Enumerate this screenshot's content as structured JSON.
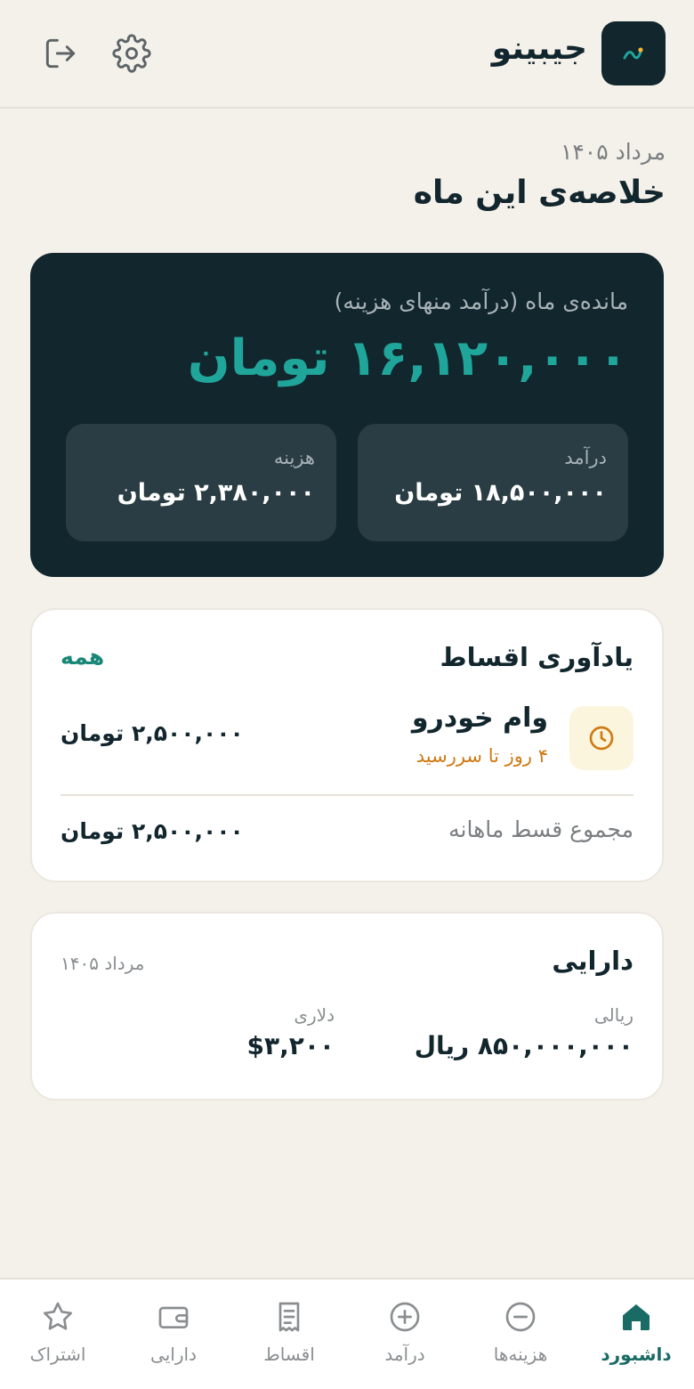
{
  "header": {
    "app_title": "جیبینو",
    "logo_icon": "trend-line-icon",
    "settings_icon": "gear-icon",
    "logout_icon": "logout-icon"
  },
  "summary": {
    "month": "مرداد ۱۴۰۵",
    "title": "خلاصه‌ی این ماه",
    "remaining_caption": "مانده‌ی ماه (درآمد منهای هزینه)",
    "remaining_amount": "۱۶,۱۲۰,۰۰۰ تومان",
    "income_label": "درآمد",
    "income_value": "۱۸,۵۰۰,۰۰۰ تومان",
    "expense_label": "هزینه",
    "expense_value": "۲,۳۸۰,۰۰۰ تومان"
  },
  "installments": {
    "title": "یادآوری اقساط",
    "see_all": "همه",
    "item": {
      "name": "وام خودرو",
      "due": "۴ روز تا سررسید",
      "amount": "۲,۵۰۰,۰۰۰ تومان",
      "icon": "clock-icon"
    },
    "total_label": "مجموع قسط ماهانه",
    "total_value": "۲,۵۰۰,۰۰۰ تومان"
  },
  "assets": {
    "title": "دارایی",
    "date": "مرداد ۱۴۰۵",
    "rial_label": "ریالی",
    "rial_value": "۸۵۰,۰۰۰,۰۰۰ ریال",
    "dollar_label": "دلاری",
    "dollar_value": "$۳,۲۰۰"
  },
  "nav": {
    "dashboard": "داشبورد",
    "expenses": "هزینه‌ها",
    "income": "درآمد",
    "installments": "اقساط",
    "assets": "دارایی",
    "subscription": "اشتراک"
  },
  "colors": {
    "background": "#f4f1eb",
    "dark_card": "#12262d",
    "accent": "#20a59a",
    "warning": "#d07a14",
    "active_nav": "#1a6a66"
  }
}
